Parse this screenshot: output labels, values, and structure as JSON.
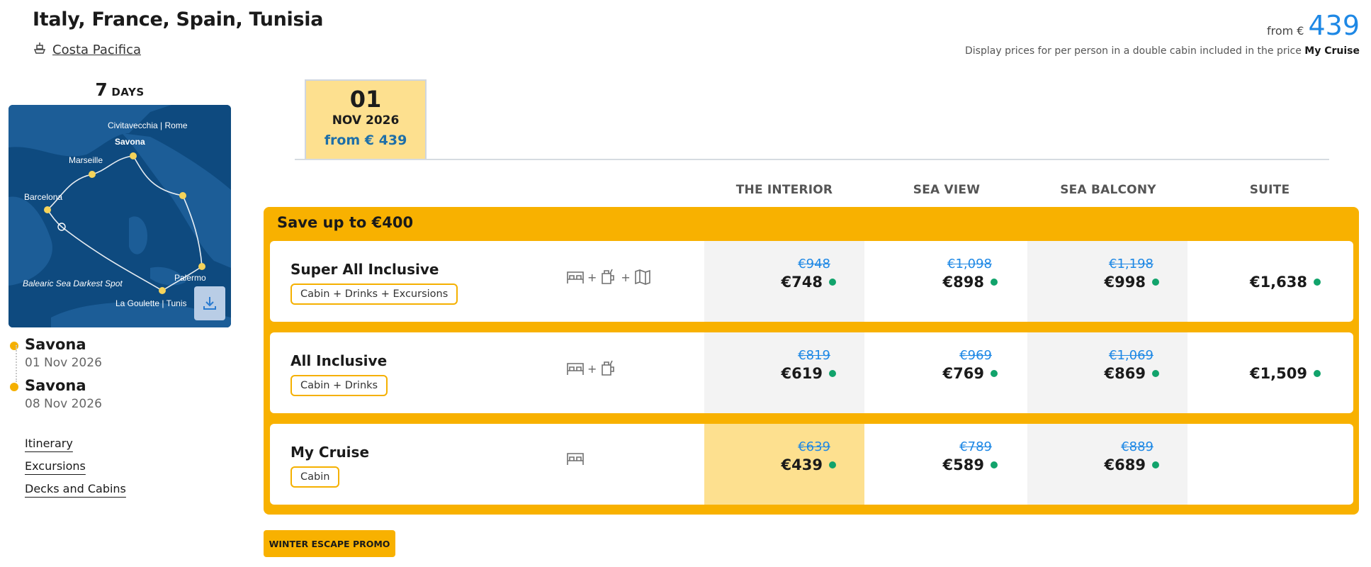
{
  "header": {
    "title": "Italy, France, Spain, Tunisia",
    "ship": "Costa Pacifica",
    "from_label": "from €",
    "from_price": "439",
    "disclaimer": "Display prices for per person in a double cabin included in the price",
    "disclaimer_bold": "My Cruise"
  },
  "trip": {
    "days_num": "7",
    "days_label": "DAYS",
    "map_labels": {
      "civitavecchia": "Civitavecchia | Rome",
      "savona": "Savona",
      "marseille": "Marseille",
      "barcelona": "Barcelona",
      "balearic": "Balearic Sea Darkest Spot",
      "palermo": "Palermo",
      "lagoulette": "La Goulette | Tunis"
    },
    "start": {
      "port": "Savona",
      "date": "01 Nov 2026"
    },
    "end": {
      "port": "Savona",
      "date": "08 Nov 2026"
    }
  },
  "links": [
    "Itinerary",
    "Excursions",
    "Decks and Cabins"
  ],
  "date_tab": {
    "day": "01",
    "month": "NOV 2026",
    "from": "from € 439"
  },
  "columns": [
    "THE INTERIOR",
    "SEA VIEW",
    "SEA BALCONY",
    "SUITE"
  ],
  "promo": {
    "title": "Save up to €400",
    "button": "WINTER ESCAPE PROMO",
    "rows": [
      {
        "name": "Super All Inclusive",
        "tag": "Cabin + Drinks + Excursions",
        "icons": [
          "bed-icon",
          "drink-icon",
          "map-icon"
        ],
        "plus": "+",
        "prices": [
          {
            "old": "€948",
            "new": "€748"
          },
          {
            "old": "€1,098",
            "new": "€898"
          },
          {
            "old": "€1,198",
            "new": "€998"
          },
          {
            "old": "",
            "new": "€1,638"
          }
        ]
      },
      {
        "name": "All Inclusive",
        "tag": "Cabin + Drinks",
        "icons": [
          "bed-icon",
          "drink-icon"
        ],
        "plus": "+",
        "prices": [
          {
            "old": "€819",
            "new": "€619"
          },
          {
            "old": "€969",
            "new": "€769"
          },
          {
            "old": "€1,069",
            "new": "€869"
          },
          {
            "old": "",
            "new": "€1,509"
          }
        ]
      },
      {
        "name": "My Cruise",
        "tag": "Cabin",
        "icons": [
          "bed-icon"
        ],
        "plus": "",
        "prices": [
          {
            "old": "€639",
            "new": "€439"
          },
          {
            "old": "€789",
            "new": "€589"
          },
          {
            "old": "€889",
            "new": "€689"
          }
        ]
      }
    ]
  },
  "colors": {
    "accent": "#f8b100",
    "highlight": "#fde08f",
    "link_blue": "#1e88e5",
    "ok_green": "#11a36b",
    "map_sea": "#0e4a7f"
  }
}
